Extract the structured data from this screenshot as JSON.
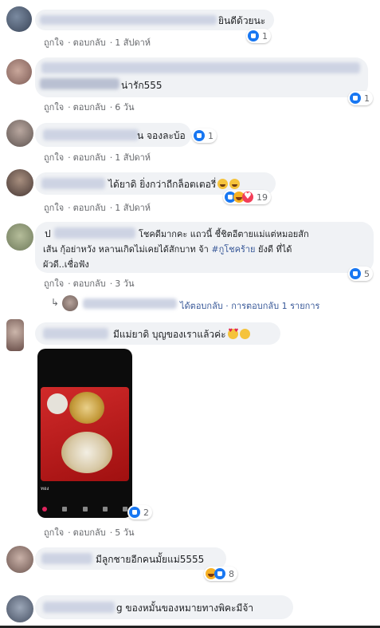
{
  "actions": {
    "like": "ถูกใจ",
    "reply": "ตอบกลับ",
    "sep": "·"
  },
  "comments": [
    {
      "text": "ยินดีด้วยนะ",
      "time": "1 สัปดาห์",
      "reaction_count": "1"
    },
    {
      "text": "น่ารัก555",
      "time": "6 วัน",
      "reaction_count": "1"
    },
    {
      "text": "น จองละบ้อ",
      "time": "1 สัปดาห์",
      "reaction_count": "1"
    },
    {
      "text": "ได้ยาดิ ยิ่งกว่าถีกล็อตเตอรี่",
      "time": "1 สัปดาห์",
      "reaction_count": "19"
    },
    {
      "prefix": "ป",
      "line1": "โชคดีมากคะ แถวนี้ ชี้ชิตอีตายแม่แต่หมอยสัก",
      "line2a": "เส้น กุ้อย่าหวัง หลานเกิดไม่เคยได้สักบาท จ้า",
      "hashtag": "#กูโชคร้าย",
      "line2b": "ยังดี ที่ได้",
      "line3": "ผัวดี..เชื่อฟัง",
      "time": "3 วัน",
      "reaction_count": "5",
      "reply_summary": "ได้ตอบกลับ · การตอบกลับ 1 รายการ"
    },
    {
      "text": "มีแม่ยาดิ บุญของเราแล้วค่ะ",
      "time": "5 วัน",
      "reaction_count": "2",
      "photo_caption": "ทอง"
    },
    {
      "text": "มีลูกชายอีกคนมั้ยแม่5555",
      "time": "",
      "reaction_count": "8"
    },
    {
      "text": "g ของหมั้นของหมายทางพิคะมีจ้า"
    }
  ],
  "colors": {
    "bubble": "#f0f2f5",
    "link": "#385898",
    "meta": "#65676b",
    "like": "#1877f2",
    "love": "#f33e58",
    "haha": "#f7b125"
  }
}
